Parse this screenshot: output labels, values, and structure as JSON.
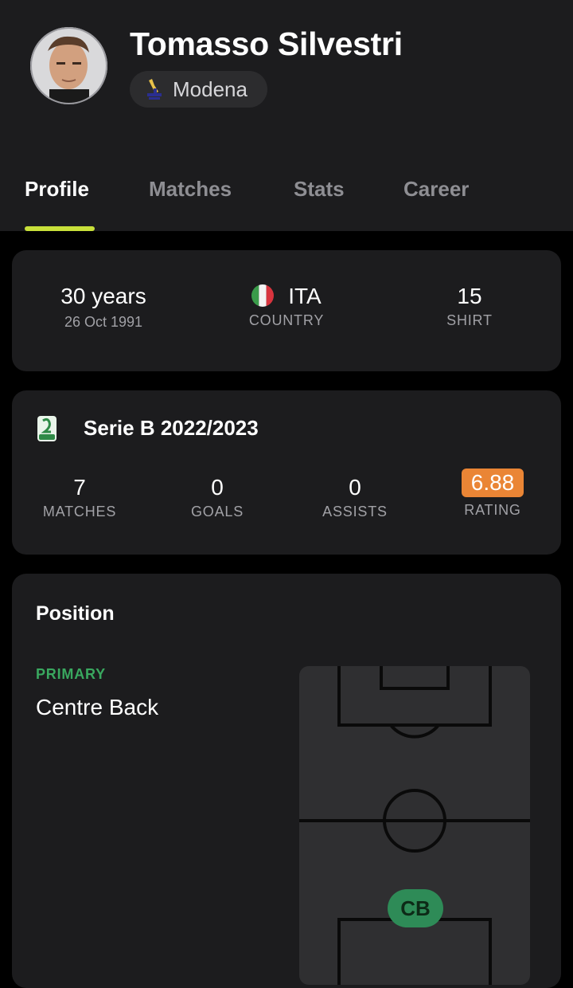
{
  "player": {
    "name": "Tomasso Silvestri",
    "team": "Modena"
  },
  "tabs": [
    "Profile",
    "Matches",
    "Stats",
    "Career"
  ],
  "active_tab": "Profile",
  "info": {
    "age": "30 years",
    "birth_date": "26 Oct 1991",
    "country_code": "ITA",
    "country_label": "COUNTRY",
    "shirt": "15",
    "shirt_label": "SHIRT"
  },
  "season": {
    "league": "Serie B 2022/2023",
    "stats": [
      {
        "value": "7",
        "label": "MATCHES"
      },
      {
        "value": "0",
        "label": "GOALS"
      },
      {
        "value": "0",
        "label": "ASSISTS"
      },
      {
        "value": "6.88",
        "label": "RATING"
      }
    ]
  },
  "position": {
    "title": "Position",
    "primary_label": "PRIMARY",
    "primary_value": "Centre Back",
    "chip": "CB"
  },
  "colors": {
    "background": "#000000",
    "card": "#1c1c1e",
    "accent": "#c8e03a",
    "rating": "#ea8535",
    "primary_green": "#39a85f",
    "chip_green": "#2e8b57"
  }
}
